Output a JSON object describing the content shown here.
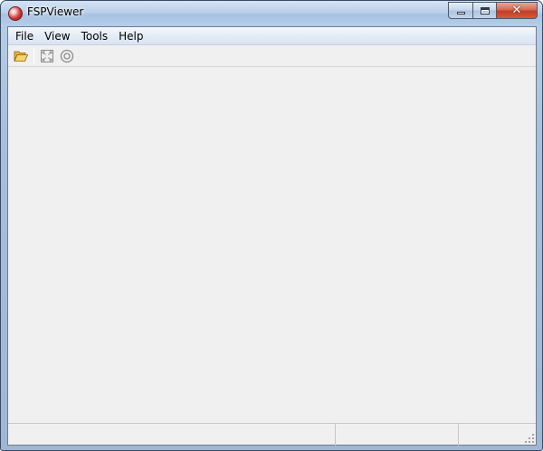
{
  "window": {
    "title": "FSPViewer",
    "icons": {
      "app": "app-logo-icon",
      "minimize": "minimize-icon",
      "maximize": "maximize-icon",
      "close": "close-icon"
    },
    "colors": {
      "frame": "#a7c0dc",
      "close_button": "#c23d21",
      "client_background": "#f0f0f0"
    }
  },
  "menubar": {
    "items": [
      "File",
      "View",
      "Tools",
      "Help"
    ]
  },
  "toolbar": {
    "buttons": [
      {
        "name": "open",
        "icon": "folder-open-icon"
      },
      {
        "name": "fullscreen",
        "icon": "fullscreen-icon"
      },
      {
        "name": "settings",
        "icon": "target-icon"
      }
    ]
  },
  "statusbar": {
    "panes": [
      "",
      "",
      ""
    ]
  }
}
